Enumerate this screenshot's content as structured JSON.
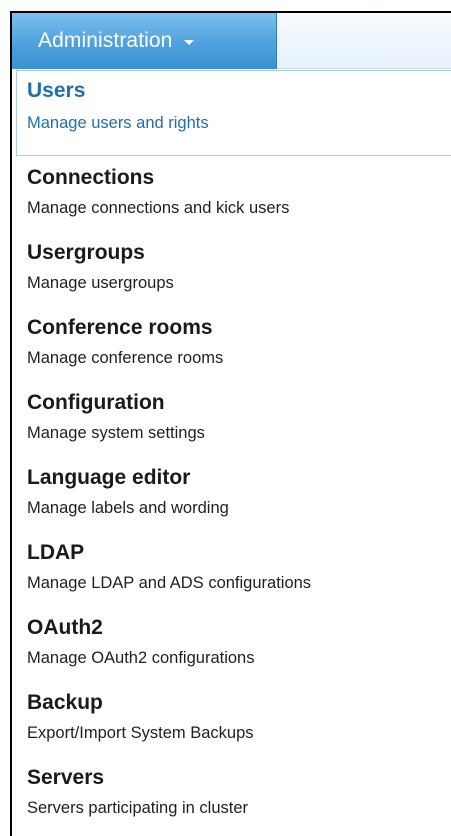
{
  "menu": {
    "label": "Administration",
    "caret_icon": "caret-down-icon"
  },
  "items": [
    {
      "title": "Users",
      "description": "Manage users and rights",
      "active": true
    },
    {
      "title": "Connections",
      "description": "Manage connections and kick users"
    },
    {
      "title": "Usergroups",
      "description": "Manage usergroups"
    },
    {
      "title": "Conference rooms",
      "description": "Manage conference rooms"
    },
    {
      "title": "Configuration",
      "description": "Manage system settings"
    },
    {
      "title": "Language editor",
      "description": "Manage labels and wording"
    },
    {
      "title": "LDAP",
      "description": "Manage LDAP and ADS configurations"
    },
    {
      "title": "OAuth2",
      "description": "Manage OAuth2 configurations"
    },
    {
      "title": "Backup",
      "description": "Export/Import System Backups"
    },
    {
      "title": "Servers",
      "description": "Servers participating in cluster"
    }
  ],
  "colors": {
    "accent": "#4ea2dd",
    "active_text": "#1d6fae"
  }
}
